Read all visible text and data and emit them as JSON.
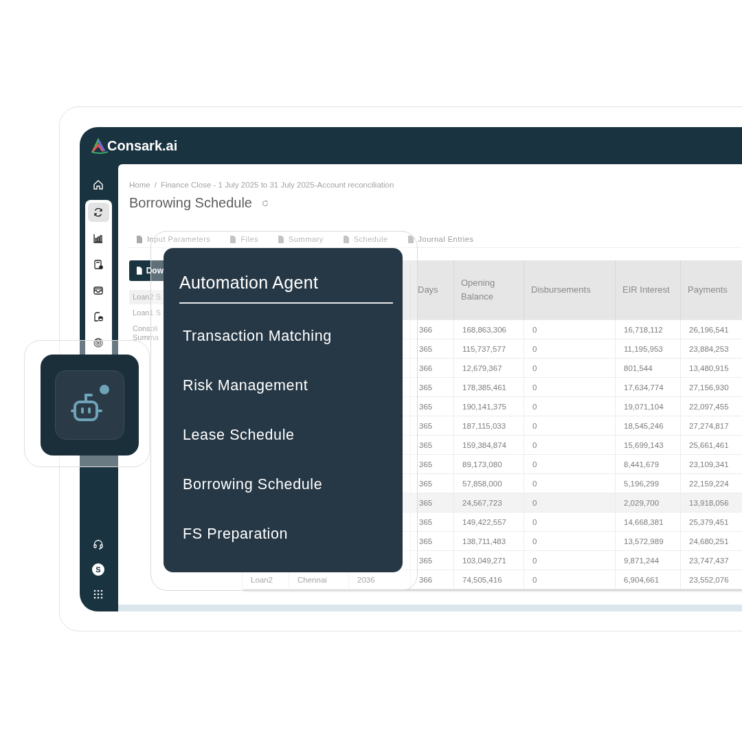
{
  "app": {
    "logo_text": "Consark.ai"
  },
  "sidebar": {
    "home": {
      "selected": false
    },
    "items": [
      {
        "selected": true
      },
      {
        "selected": false
      },
      {
        "selected": false
      },
      {
        "selected": false
      },
      {
        "selected": false
      },
      {
        "selected": false
      }
    ],
    "avatar_initial": "S"
  },
  "breadcrumb": {
    "items": [
      "Home",
      "Finance Close - 1 July 2025 to 31 July 2025-Account reconciliation"
    ],
    "separator": "/"
  },
  "page_title": "Borrowing Schedule",
  "tabs": [
    {
      "label": "Input Parameters"
    },
    {
      "label": "Files"
    },
    {
      "label": "Summary"
    },
    {
      "label": "Schedule"
    },
    {
      "label": "Journal Entries"
    }
  ],
  "download_button": {
    "label": "Dow"
  },
  "side_list": [
    {
      "lines": [
        "Loan2 S"
      ],
      "selected": true
    },
    {
      "lines": [
        "Loan1 S"
      ],
      "selected": false
    },
    {
      "lines": [
        "Consoli",
        "Summa"
      ],
      "selected": false
    }
  ],
  "table": {
    "columns": [
      "",
      "",
      "",
      "Days",
      "Opening Balance",
      "Disbursements",
      "EIR Interest",
      "Payments"
    ],
    "rows": [
      {
        "cells": [
          "",
          "",
          "",
          "366",
          "168,863,306",
          "0",
          "16,718,112",
          "26,196,541"
        ],
        "highlighted": false
      },
      {
        "cells": [
          "",
          "",
          "",
          "365",
          "115,737,577",
          "0",
          "11,195,953",
          "23,884,253"
        ],
        "highlighted": false
      },
      {
        "cells": [
          "",
          "",
          "",
          "366",
          "12,679,367",
          "0",
          "801,544",
          "13,480,915"
        ],
        "highlighted": false
      },
      {
        "cells": [
          "",
          "",
          "",
          "365",
          "178,385,461",
          "0",
          "17,634,774",
          "27,156,930"
        ],
        "highlighted": false
      },
      {
        "cells": [
          "",
          "",
          "",
          "365",
          "190,141,375",
          "0",
          "19,071,104",
          "22,097,455"
        ],
        "highlighted": false
      },
      {
        "cells": [
          "",
          "",
          "",
          "365",
          "187,115,033",
          "0",
          "18,545,246",
          "27,274,817"
        ],
        "highlighted": false
      },
      {
        "cells": [
          "",
          "",
          "",
          "365",
          "159,384,874",
          "0",
          "15,699,143",
          "25,661,461"
        ],
        "highlighted": false
      },
      {
        "cells": [
          "",
          "",
          "",
          "365",
          "89,173,080",
          "0",
          "8,441,679",
          "23,109,341"
        ],
        "highlighted": false
      },
      {
        "cells": [
          "",
          "",
          "",
          "365",
          "57,858,000",
          "0",
          "5,196,299",
          "22,159,224"
        ],
        "highlighted": false
      },
      {
        "cells": [
          "",
          "",
          "",
          "365",
          "24,567,723",
          "0",
          "2,029,700",
          "13,918,056"
        ],
        "highlighted": true
      },
      {
        "cells": [
          "",
          "",
          "",
          "365",
          "149,422,557",
          "0",
          "14,668,381",
          "25,379,451"
        ],
        "highlighted": false
      },
      {
        "cells": [
          "",
          "",
          "",
          "365",
          "138,711,483",
          "0",
          "13,572,989",
          "24,680,251"
        ],
        "highlighted": false
      },
      {
        "cells": [
          "",
          "",
          "",
          "365",
          "103,049,271",
          "0",
          "9,871,244",
          "23,747,437"
        ],
        "highlighted": false
      },
      {
        "cells": [
          "Loan2",
          "Chennai",
          "2036",
          "366",
          "74,505,416",
          "0",
          "6,904,661",
          "23,552,076"
        ],
        "highlighted": false
      }
    ]
  },
  "agent_button": {
    "notification": true
  },
  "agent_menu": {
    "title": "Automation Agent",
    "items": [
      {
        "label": "Transaction Matching",
        "selected": false
      },
      {
        "label": "Risk Management",
        "selected": false
      },
      {
        "label": "Lease Schedule",
        "selected": false
      },
      {
        "label": "Borrowing Schedule",
        "selected": false
      },
      {
        "label": "FS Preparation",
        "selected": false
      }
    ]
  }
}
